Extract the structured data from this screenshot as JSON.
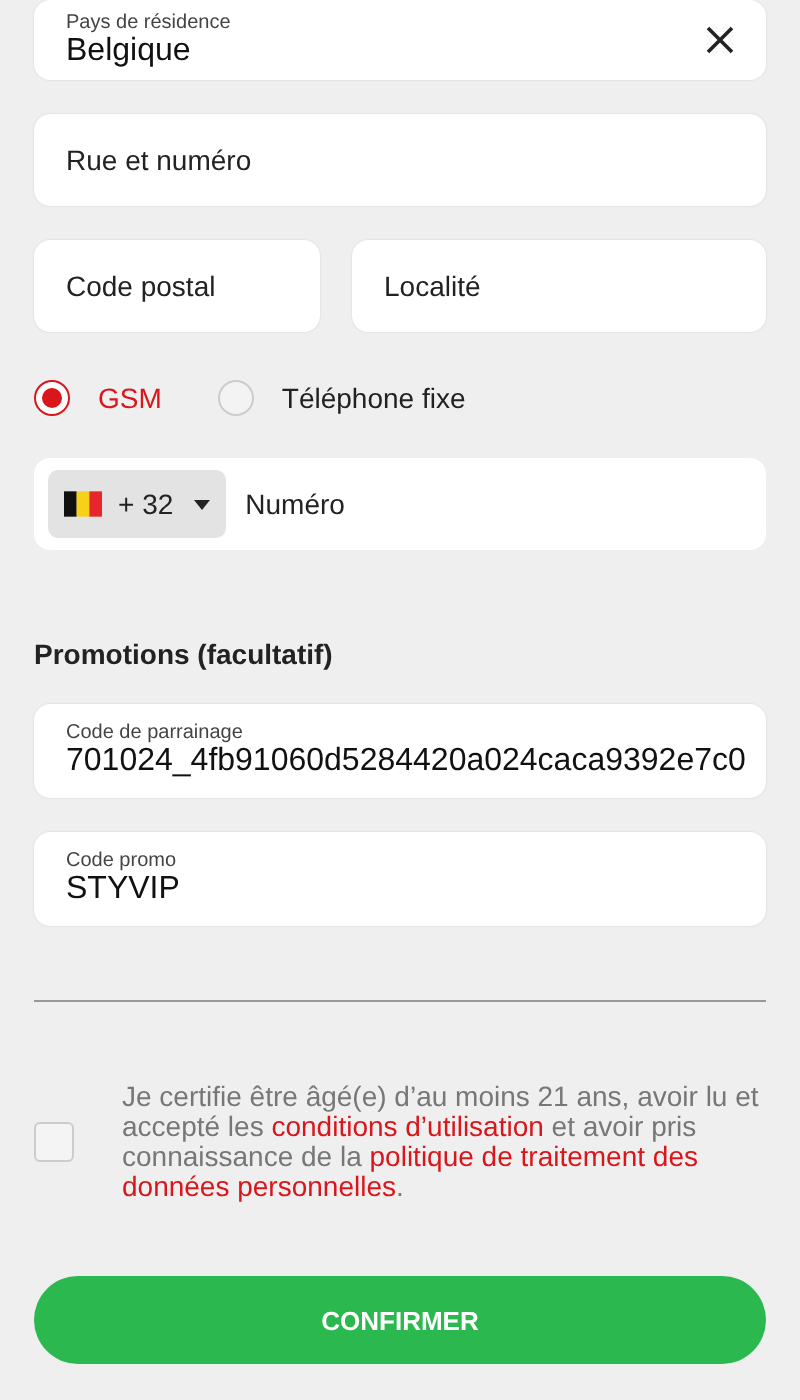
{
  "fields_top": [
    {
      "kind": "select",
      "label": "Pays de résidence",
      "value": "Belgique"
    },
    {
      "kind": "text",
      "placeholder": "Rue et numéro"
    }
  ],
  "address_row": [
    {
      "placeholder": "Code postal"
    },
    {
      "placeholder": "Localité"
    }
  ],
  "phone_type": [
    {
      "label": "GSM",
      "selected": true
    },
    {
      "label": "Téléphone fixe",
      "selected": false
    }
  ],
  "phone": {
    "prefix": "+ 32",
    "placeholder": "Numéro"
  },
  "promotions": {
    "title": "Promotions (facultatif)",
    "fields": [
      {
        "label": "Code de parrainage",
        "value": "701024_4fb91060d5284420a024caca9392e7c0"
      },
      {
        "label": "Code promo",
        "value": "STYVIP"
      }
    ]
  },
  "consent": {
    "checked": false,
    "parts": [
      {
        "kind": "text",
        "text": "Je certifie être âgé(e) d’au moins 21 ans, avoir lu et accepté les "
      },
      {
        "kind": "link",
        "text": "conditions d’utilisation"
      },
      {
        "kind": "text",
        "text": " et avoir pris connaissance de la "
      },
      {
        "kind": "link",
        "text": "politique de traitement des"
      },
      {
        "kind": "break"
      },
      {
        "kind": "link",
        "text": "données personnelles"
      },
      {
        "kind": "text",
        "text": "."
      }
    ]
  },
  "confirm_button": "CONFIRMER"
}
